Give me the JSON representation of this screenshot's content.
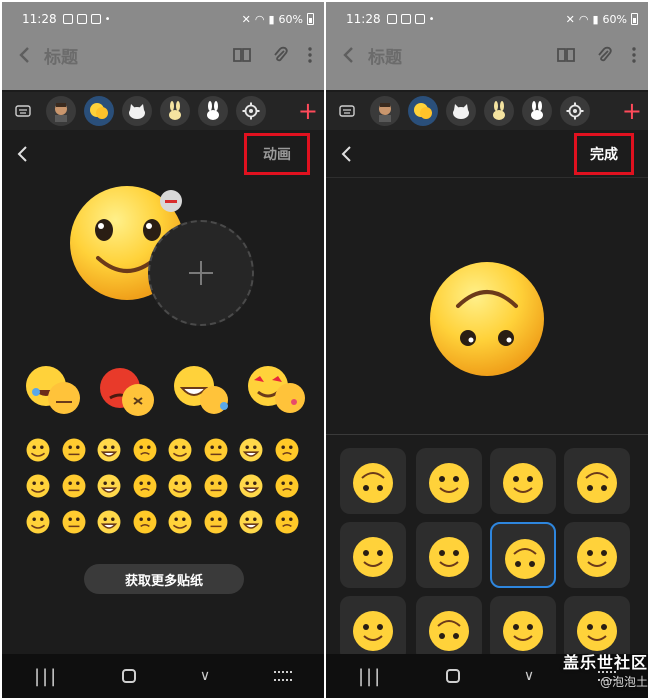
{
  "status_bar": {
    "time": "11:28",
    "battery": "60%"
  },
  "app_bar": {
    "title": "标题"
  },
  "left_screen": {
    "header_button": "动画",
    "get_more_button": "获取更多贴纸"
  },
  "right_screen": {
    "header_button": "完成"
  },
  "watermark": {
    "main": "盖乐世社区",
    "sub": "@泡泡土"
  },
  "colors": {
    "accent_red": "#e0111f",
    "plus_red": "#ff4a5a",
    "selection_blue": "#2e86de",
    "emoji_yellow": "#ffd23a"
  }
}
